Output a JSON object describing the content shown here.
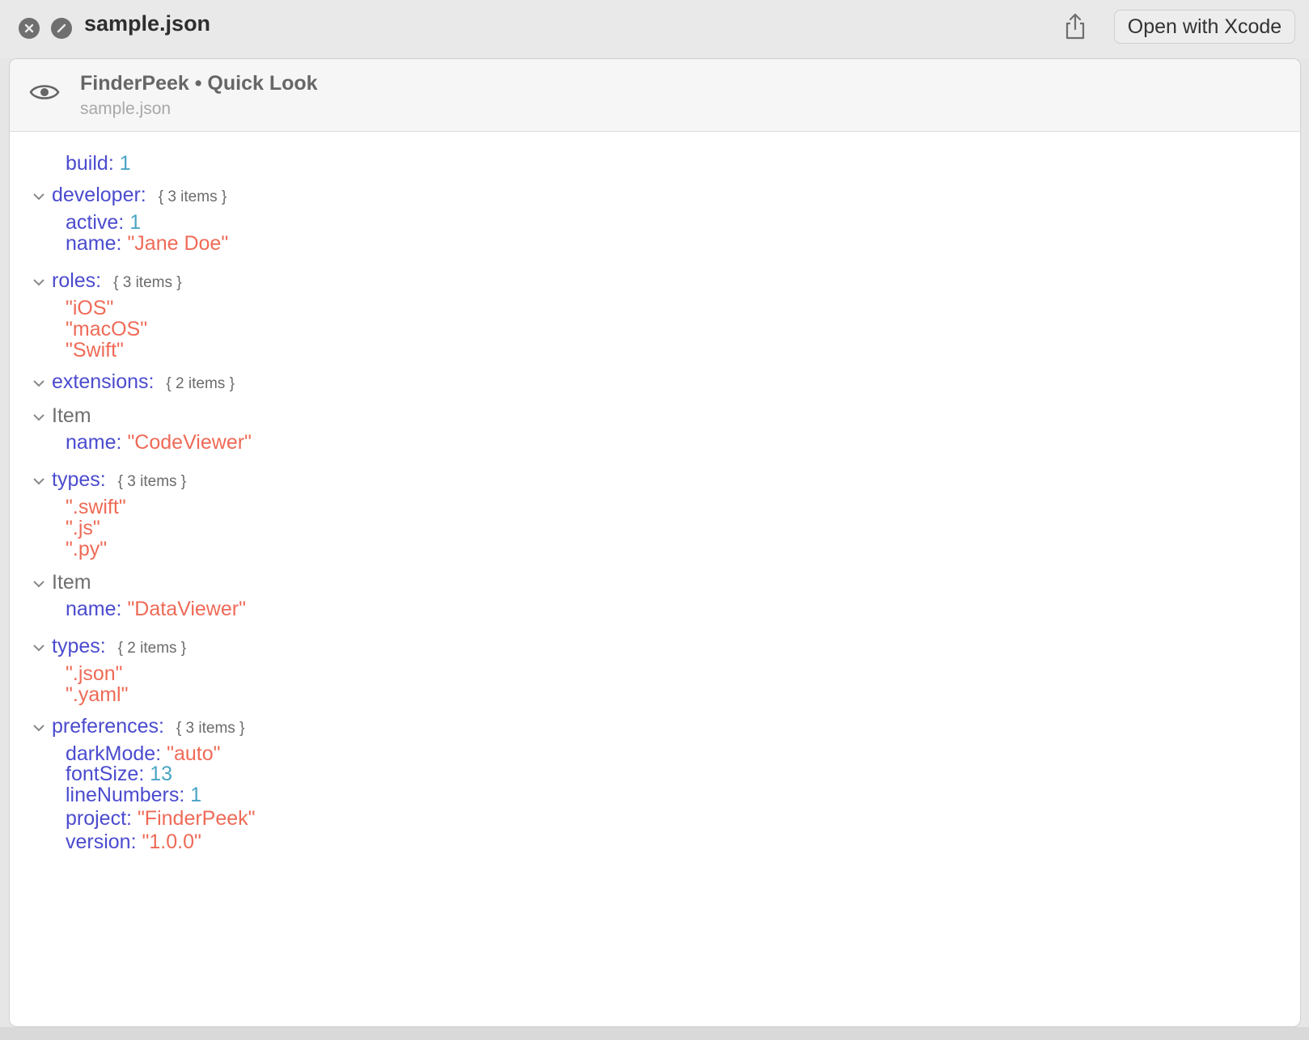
{
  "window": {
    "title": "sample.json",
    "open_button": "Open with Xcode"
  },
  "quicklook": {
    "title": "FinderPeek • Quick Look",
    "subtitle": "sample.json"
  },
  "tree": {
    "build": {
      "key": "build:",
      "value": "1"
    },
    "developer": {
      "key": "developer:",
      "meta": "{ 3 items }",
      "active": {
        "key": "active:",
        "value": "1"
      },
      "name": {
        "key": "name:",
        "value": "\"Jane Doe\""
      }
    },
    "roles": {
      "key": "roles:",
      "meta": "{ 3 items }",
      "items": [
        "\"iOS\"",
        "\"macOS\"",
        "\"Swift\""
      ]
    },
    "extensions": {
      "key": "extensions:",
      "meta": "{ 2 items }",
      "item1": {
        "label": "Item",
        "name": {
          "key": "name:",
          "value": "\"CodeViewer\""
        },
        "types": {
          "key": "types:",
          "meta": "{ 3 items }",
          "items": [
            "\".swift\"",
            "\".js\"",
            "\".py\""
          ]
        }
      },
      "item2": {
        "label": "Item",
        "name": {
          "key": "name:",
          "value": "\"DataViewer\""
        },
        "types": {
          "key": "types:",
          "meta": "{ 2 items }",
          "items": [
            "\".json\"",
            "\".yaml\""
          ]
        }
      }
    },
    "preferences": {
      "key": "preferences:",
      "meta": "{ 3 items }",
      "darkMode": {
        "key": "darkMode:",
        "value": "\"auto\""
      },
      "fontSize": {
        "key": "fontSize:",
        "value": "13"
      },
      "lineNumbers": {
        "key": "lineNumbers:",
        "value": "1"
      }
    },
    "project": {
      "key": "project:",
      "value": "\"FinderPeek\""
    },
    "version": {
      "key": "version:",
      "value": "\"1.0.0\""
    }
  },
  "colors": {
    "key": "#4b4bcf",
    "string": "#ef6a57",
    "number": "#4aa4c4"
  },
  "icons": [
    "close-icon",
    "minimize-icon",
    "share-icon",
    "eye-icon",
    "chevron-down-icon"
  ]
}
